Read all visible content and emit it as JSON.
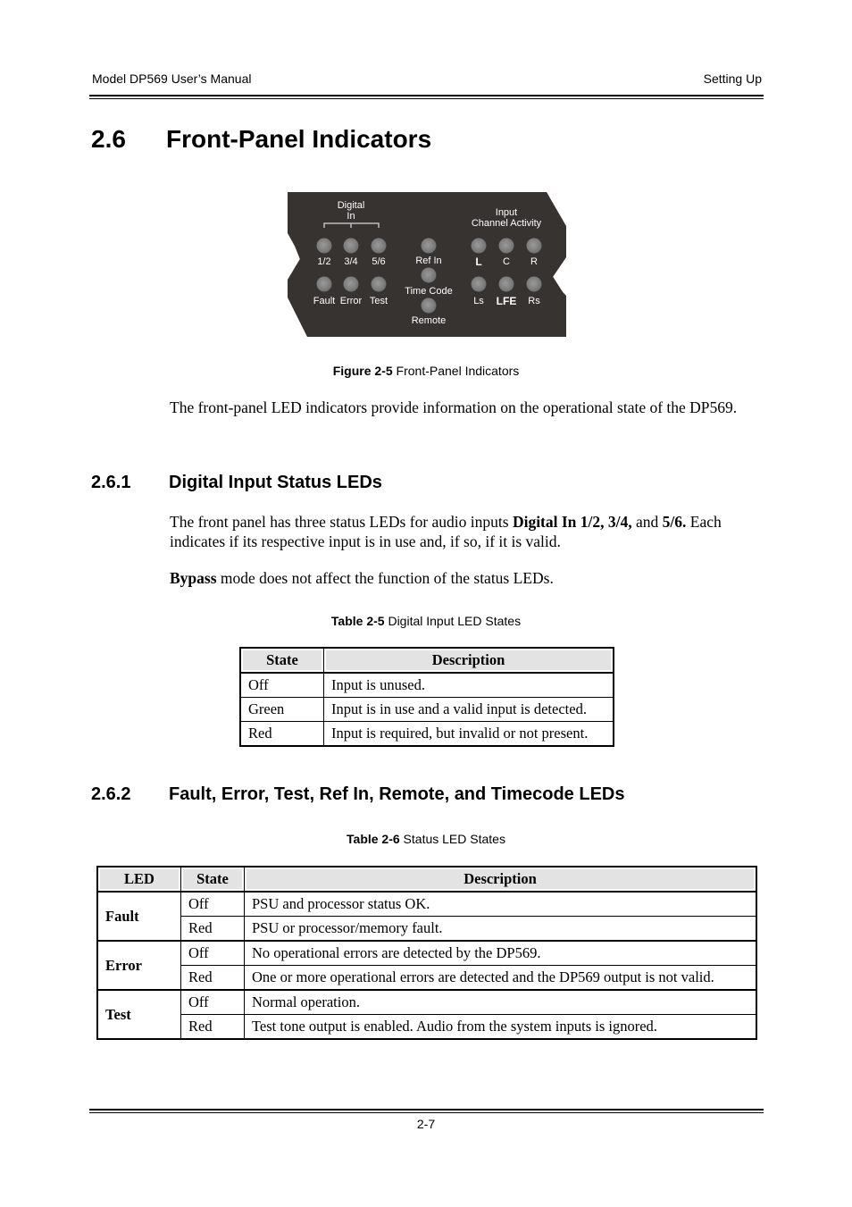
{
  "header": {
    "left": "Model DP569 User’s Manual",
    "right": "Setting Up"
  },
  "section": {
    "number": "2.6",
    "title": "Front-Panel Indicators"
  },
  "figure": {
    "panel": {
      "digital_in_title_line1": "Digital",
      "digital_in_title_line2": "In",
      "input_activity_title_line1": "Input",
      "input_activity_title_line2": "Channel Activity",
      "digital_leds": [
        "1/2",
        "3/4",
        "5/6"
      ],
      "status_leds": [
        "Fault",
        "Error",
        "Test"
      ],
      "center_leds": [
        "Ref In",
        "Time Code",
        "Remote"
      ],
      "channel_leds_top": [
        "L",
        "C",
        "R"
      ],
      "channel_leds_bottom": [
        "Ls",
        "LFE",
        "Rs"
      ],
      "panel_color": "#363330",
      "led_color": "#7b7b7b"
    },
    "caption_label": "Figure 2-5",
    "caption_text": " Front-Panel Indicators"
  },
  "intro_paragraph": "The front-panel LED indicators provide information on the operational state of the DP569.",
  "subsection1": {
    "number": "2.6.1",
    "title": "Digital Input Status LEDs",
    "para1_a": "The front panel has three status LEDs for audio inputs ",
    "para1_bold1": "Digital In 1/2, 3/4,",
    "para1_and": " and ",
    "para1_bold2": "5/6.",
    "para1_b": " Each indicates if its respective input is in use and, if so, if it is valid.",
    "para2_bold": "Bypass",
    "para2_rest": " mode does not affect the function of the status LEDs.",
    "table_caption_label": "Table 2-5",
    "table_caption_text": " Digital Input LED States",
    "table": {
      "headers": [
        "State",
        "Description"
      ],
      "rows": [
        [
          "Off",
          "Input is unused."
        ],
        [
          "Green",
          "Input is in use and a valid input is detected."
        ],
        [
          "Red",
          "Input is required, but invalid or not present."
        ]
      ]
    }
  },
  "subsection2": {
    "number": "2.6.2",
    "title": "Fault, Error, Test, Ref In, Remote, and Timecode LEDs",
    "table_caption_label": "Table 2-6",
    "table_caption_text": " Status LED States",
    "table": {
      "headers": [
        "LED",
        "State",
        "Description"
      ],
      "groups": [
        {
          "led": "Fault",
          "rows": [
            [
              "Off",
              "PSU and processor status OK."
            ],
            [
              "Red",
              "PSU or processor/memory fault."
            ]
          ]
        },
        {
          "led": "Error",
          "rows": [
            [
              "Off",
              "No operational errors are detected by the DP569."
            ],
            [
              "Red",
              "One or more operational errors are detected and the DP569 output is not valid."
            ]
          ]
        },
        {
          "led": "Test",
          "rows": [
            [
              "Off",
              "Normal operation."
            ],
            [
              "Red",
              "Test tone output is enabled. Audio from the system inputs is ignored."
            ]
          ]
        }
      ]
    }
  },
  "footer": {
    "page_number": "2-7"
  }
}
